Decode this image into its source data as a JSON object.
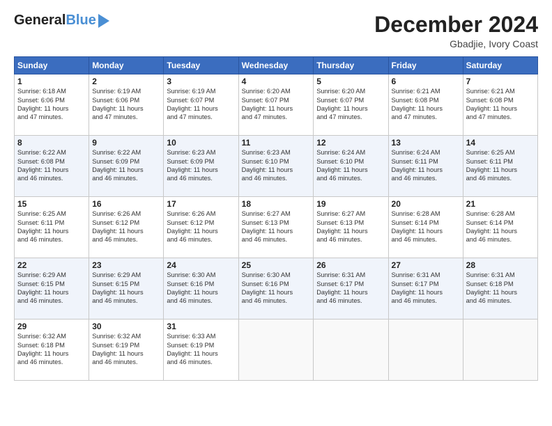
{
  "header": {
    "logo_general": "General",
    "logo_blue": "Blue",
    "month": "December 2024",
    "location": "Gbadjie, Ivory Coast"
  },
  "weekdays": [
    "Sunday",
    "Monday",
    "Tuesday",
    "Wednesday",
    "Thursday",
    "Friday",
    "Saturday"
  ],
  "weeks": [
    [
      {
        "day": "1",
        "info": "Sunrise: 6:18 AM\nSunset: 6:06 PM\nDaylight: 11 hours\nand 47 minutes."
      },
      {
        "day": "2",
        "info": "Sunrise: 6:19 AM\nSunset: 6:06 PM\nDaylight: 11 hours\nand 47 minutes."
      },
      {
        "day": "3",
        "info": "Sunrise: 6:19 AM\nSunset: 6:07 PM\nDaylight: 11 hours\nand 47 minutes."
      },
      {
        "day": "4",
        "info": "Sunrise: 6:20 AM\nSunset: 6:07 PM\nDaylight: 11 hours\nand 47 minutes."
      },
      {
        "day": "5",
        "info": "Sunrise: 6:20 AM\nSunset: 6:07 PM\nDaylight: 11 hours\nand 47 minutes."
      },
      {
        "day": "6",
        "info": "Sunrise: 6:21 AM\nSunset: 6:08 PM\nDaylight: 11 hours\nand 47 minutes."
      },
      {
        "day": "7",
        "info": "Sunrise: 6:21 AM\nSunset: 6:08 PM\nDaylight: 11 hours\nand 47 minutes."
      }
    ],
    [
      {
        "day": "8",
        "info": "Sunrise: 6:22 AM\nSunset: 6:08 PM\nDaylight: 11 hours\nand 46 minutes."
      },
      {
        "day": "9",
        "info": "Sunrise: 6:22 AM\nSunset: 6:09 PM\nDaylight: 11 hours\nand 46 minutes."
      },
      {
        "day": "10",
        "info": "Sunrise: 6:23 AM\nSunset: 6:09 PM\nDaylight: 11 hours\nand 46 minutes."
      },
      {
        "day": "11",
        "info": "Sunrise: 6:23 AM\nSunset: 6:10 PM\nDaylight: 11 hours\nand 46 minutes."
      },
      {
        "day": "12",
        "info": "Sunrise: 6:24 AM\nSunset: 6:10 PM\nDaylight: 11 hours\nand 46 minutes."
      },
      {
        "day": "13",
        "info": "Sunrise: 6:24 AM\nSunset: 6:11 PM\nDaylight: 11 hours\nand 46 minutes."
      },
      {
        "day": "14",
        "info": "Sunrise: 6:25 AM\nSunset: 6:11 PM\nDaylight: 11 hours\nand 46 minutes."
      }
    ],
    [
      {
        "day": "15",
        "info": "Sunrise: 6:25 AM\nSunset: 6:11 PM\nDaylight: 11 hours\nand 46 minutes."
      },
      {
        "day": "16",
        "info": "Sunrise: 6:26 AM\nSunset: 6:12 PM\nDaylight: 11 hours\nand 46 minutes."
      },
      {
        "day": "17",
        "info": "Sunrise: 6:26 AM\nSunset: 6:12 PM\nDaylight: 11 hours\nand 46 minutes."
      },
      {
        "day": "18",
        "info": "Sunrise: 6:27 AM\nSunset: 6:13 PM\nDaylight: 11 hours\nand 46 minutes."
      },
      {
        "day": "19",
        "info": "Sunrise: 6:27 AM\nSunset: 6:13 PM\nDaylight: 11 hours\nand 46 minutes."
      },
      {
        "day": "20",
        "info": "Sunrise: 6:28 AM\nSunset: 6:14 PM\nDaylight: 11 hours\nand 46 minutes."
      },
      {
        "day": "21",
        "info": "Sunrise: 6:28 AM\nSunset: 6:14 PM\nDaylight: 11 hours\nand 46 minutes."
      }
    ],
    [
      {
        "day": "22",
        "info": "Sunrise: 6:29 AM\nSunset: 6:15 PM\nDaylight: 11 hours\nand 46 minutes."
      },
      {
        "day": "23",
        "info": "Sunrise: 6:29 AM\nSunset: 6:15 PM\nDaylight: 11 hours\nand 46 minutes."
      },
      {
        "day": "24",
        "info": "Sunrise: 6:30 AM\nSunset: 6:16 PM\nDaylight: 11 hours\nand 46 minutes."
      },
      {
        "day": "25",
        "info": "Sunrise: 6:30 AM\nSunset: 6:16 PM\nDaylight: 11 hours\nand 46 minutes."
      },
      {
        "day": "26",
        "info": "Sunrise: 6:31 AM\nSunset: 6:17 PM\nDaylight: 11 hours\nand 46 minutes."
      },
      {
        "day": "27",
        "info": "Sunrise: 6:31 AM\nSunset: 6:17 PM\nDaylight: 11 hours\nand 46 minutes."
      },
      {
        "day": "28",
        "info": "Sunrise: 6:31 AM\nSunset: 6:18 PM\nDaylight: 11 hours\nand 46 minutes."
      }
    ],
    [
      {
        "day": "29",
        "info": "Sunrise: 6:32 AM\nSunset: 6:18 PM\nDaylight: 11 hours\nand 46 minutes."
      },
      {
        "day": "30",
        "info": "Sunrise: 6:32 AM\nSunset: 6:19 PM\nDaylight: 11 hours\nand 46 minutes."
      },
      {
        "day": "31",
        "info": "Sunrise: 6:33 AM\nSunset: 6:19 PM\nDaylight: 11 hours\nand 46 minutes."
      },
      null,
      null,
      null,
      null
    ]
  ]
}
